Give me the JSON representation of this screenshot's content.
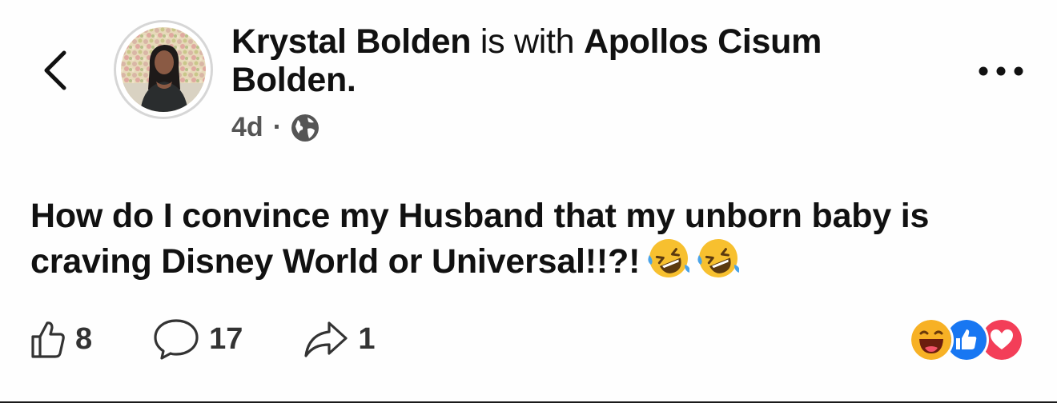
{
  "post": {
    "author": "Krystal Bolden",
    "joiner": "is with",
    "tagged": "Apollos Cisum Bolden",
    "end_punct": ".",
    "time": "4d",
    "separator": "·",
    "privacy_icon": "globe-icon",
    "text": "How do I convince my Husband that my unborn baby is craving Disney World or Universal!!?!",
    "text_emojis": [
      "rolling-on-floor-laughing-emoji",
      "rolling-on-floor-laughing-emoji"
    ]
  },
  "actions": {
    "like": {
      "icon": "thumbs-up-icon",
      "count": "8"
    },
    "comment": {
      "icon": "comment-bubble-icon",
      "count": "17"
    },
    "share": {
      "icon": "share-arrow-icon",
      "count": "1"
    }
  },
  "reactions": [
    "haha",
    "like",
    "love"
  ],
  "colors": {
    "background": "#fefefe",
    "text": "#111111",
    "muted": "#555555",
    "like_blue": "#1877f2",
    "love_red": "#f33e58",
    "haha_yellow": "#f7b125"
  }
}
